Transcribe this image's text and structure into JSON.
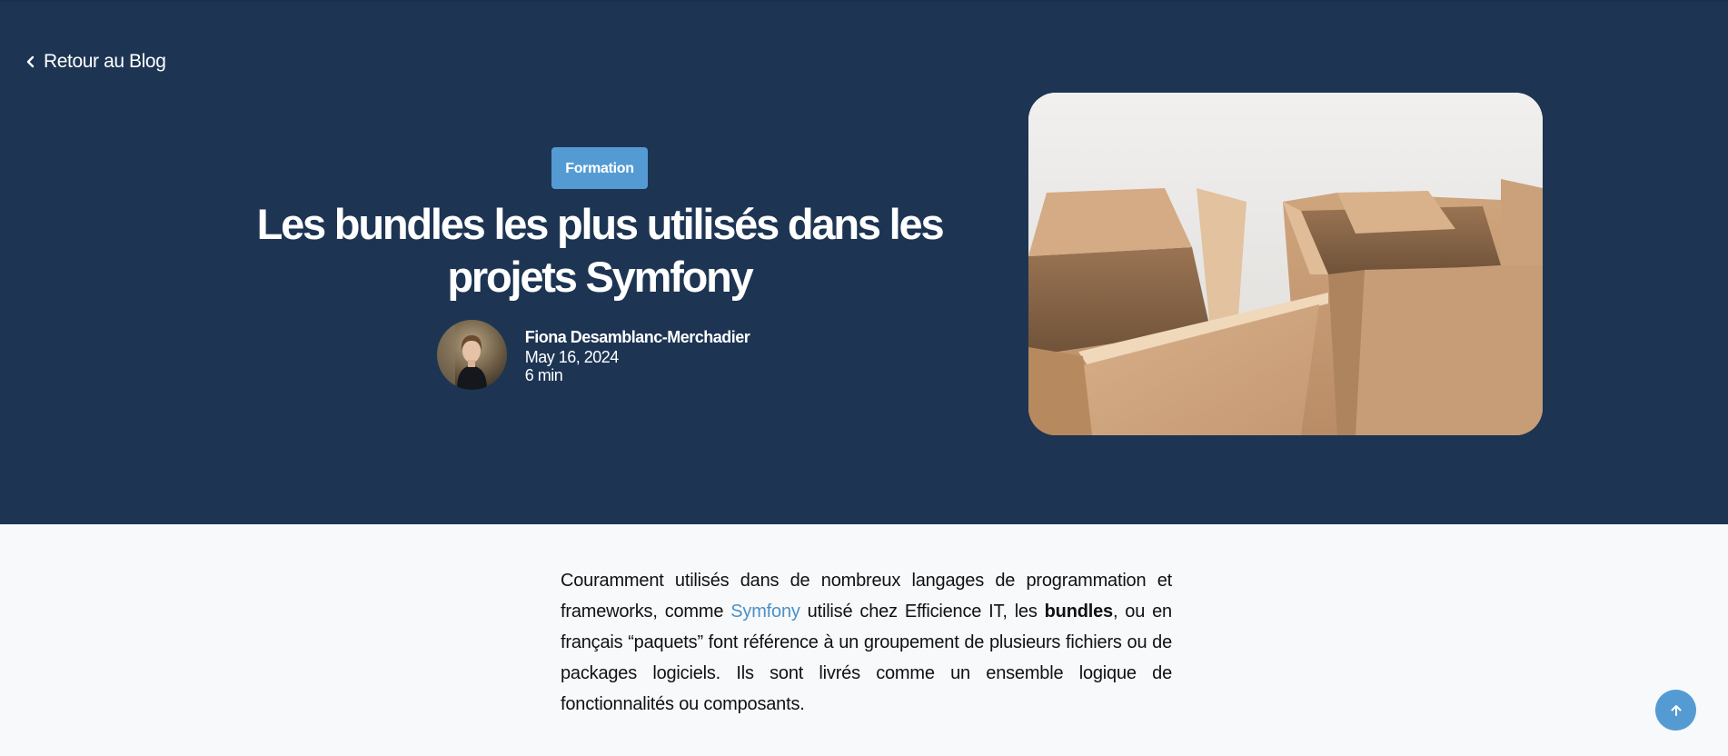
{
  "nav": {
    "back_label": "Retour au Blog"
  },
  "article": {
    "category": "Formation",
    "title": "Les bundles les plus utilisés dans les projets Symfony",
    "author": {
      "name": "Fiona Desamblanc-Merchadier",
      "date": "May 16, 2024",
      "read_time": "6 min"
    },
    "intro": {
      "part1": "Couramment utilisés dans de nombreux langages de programmation et frameworks, comme ",
      "link": "Symfony",
      "part2": " utilisé chez Efficience IT, les ",
      "bold": "bundles",
      "part3": ", ou en français “paquets” font référence à un groupement de plusieurs fichiers ou de packages logiciels. Ils sont livrés comme un ensemble logique de fonctionnalités ou composants."
    }
  },
  "colors": {
    "hero_bg": "#1d3553",
    "accent": "#559bd3",
    "link": "#4a90c8",
    "page_bg": "#f8f9fb"
  },
  "icons": {
    "back": "chevron-left-icon",
    "to_top": "arrow-up-icon"
  }
}
